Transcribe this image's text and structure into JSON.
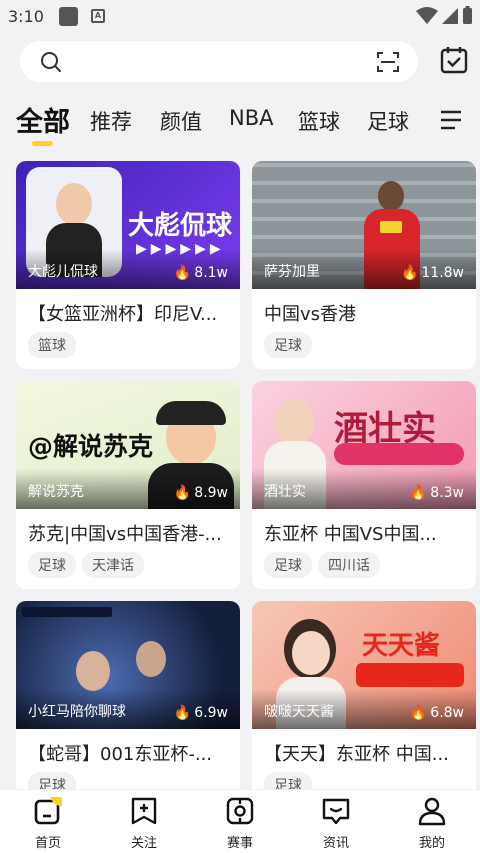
{
  "status": {
    "time": "3:10"
  },
  "search": {
    "placeholder": ""
  },
  "tabs": [
    "全部",
    "推荐",
    "颜值",
    "NBA",
    "篮球",
    "足球"
  ],
  "cards": [
    {
      "anchor": "大彪儿侃球",
      "heat": "8.1w",
      "title": "【女篮亚洲杯】印尼V...",
      "tags": [
        "篮球"
      ],
      "art": "大彪侃球",
      "colors": [
        "#4b2bd0",
        "#7a3cf2"
      ]
    },
    {
      "anchor": "萨芬加里",
      "heat": "11.8w",
      "title": "中国vs香港",
      "tags": [
        "足球"
      ],
      "art": "",
      "colors": [
        "#6f7a82",
        "#9aa3a9"
      ]
    },
    {
      "anchor": "解说苏克",
      "heat": "8.9w",
      "title": "苏克|中国vs中国香港-...",
      "tags": [
        "足球",
        "天津话"
      ],
      "art": "@解说苏克",
      "colors": [
        "#2a8a45",
        "#e9f3d0"
      ]
    },
    {
      "anchor": "酒壮实",
      "heat": "8.3w",
      "title": "东亚杯 中国VS中国...",
      "tags": [
        "足球",
        "四川话"
      ],
      "art": "酒壮实",
      "colors": [
        "#f25c84",
        "#f9b6c8"
      ]
    },
    {
      "anchor": "小红马陪你聊球",
      "heat": "6.9w",
      "title": "【蛇哥】001东亚杯-...",
      "tags": [
        "足球"
      ],
      "art": "",
      "colors": [
        "#1b2a52",
        "#3c5496"
      ]
    },
    {
      "anchor": "啵啵天天酱",
      "heat": "6.8w",
      "title": "【天天】东亚杯 中国...",
      "tags": [
        "足球"
      ],
      "art": "天天酱",
      "colors": [
        "#ef4a3b",
        "#f7b8a4"
      ]
    }
  ],
  "nav": [
    "首页",
    "关注",
    "赛事",
    "资讯",
    "我的"
  ]
}
